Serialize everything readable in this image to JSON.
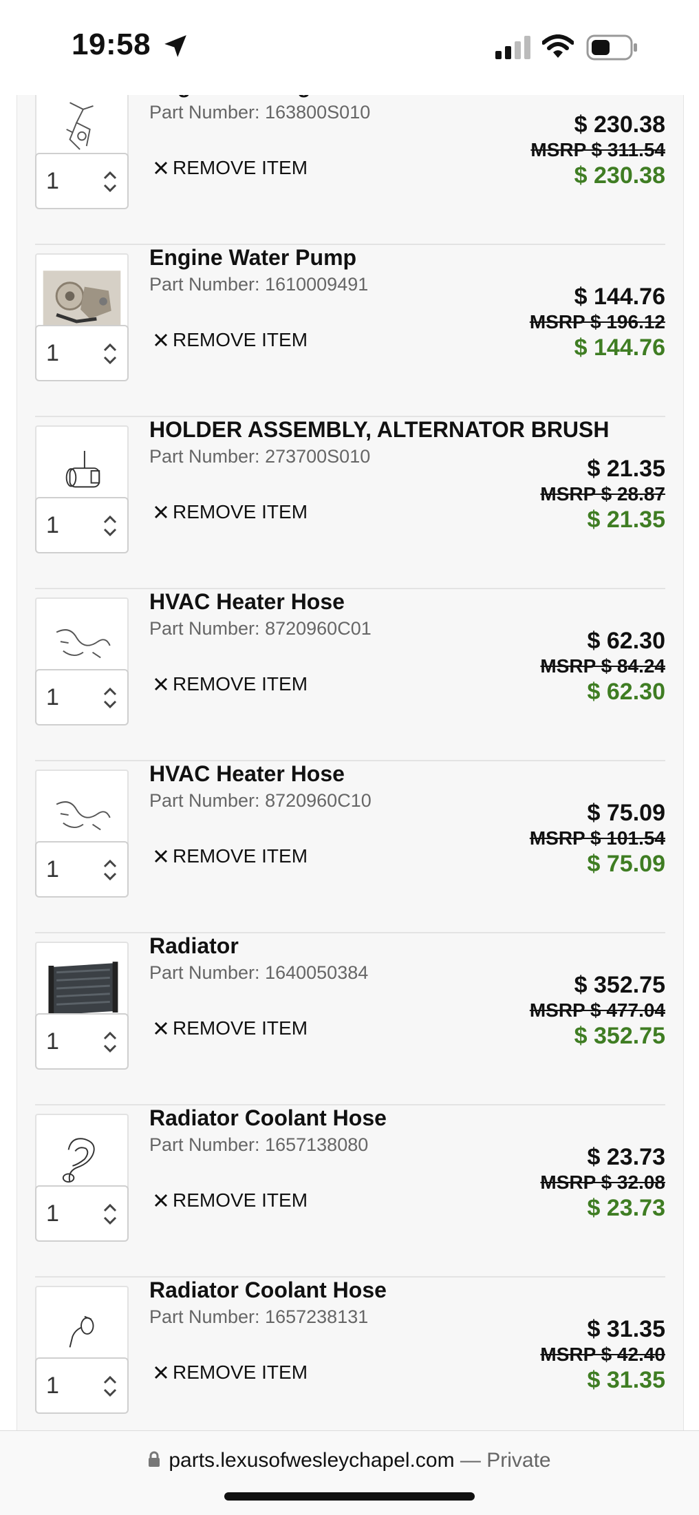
{
  "status_bar": {
    "time": "19:58"
  },
  "cart": {
    "items": [
      {
        "name": "Engine Cooling Fan Clutch Bracket",
        "part_label": "Part Number:",
        "part_number": "163800S010",
        "qty": "1",
        "remove_label": "REMOVE ITEM",
        "price": "$ 230.38",
        "msrp": "MSRP $ 311.54",
        "sale_price": "$ 230.38",
        "image": "bracket-drawing"
      },
      {
        "name": "Engine Water Pump",
        "part_label": "Part Number:",
        "part_number": "1610009491",
        "qty": "1",
        "remove_label": "REMOVE ITEM",
        "price": "$ 144.76",
        "msrp": "MSRP $ 196.12",
        "sale_price": "$ 144.76",
        "image": "water-pump-photo"
      },
      {
        "name": "HOLDER ASSEMBLY, ALTERNATOR BRUSH",
        "part_label": "Part Number:",
        "part_number": "273700S010",
        "qty": "1",
        "remove_label": "REMOVE ITEM",
        "price": "$ 21.35",
        "msrp": "MSRP $ 28.87",
        "sale_price": "$ 21.35",
        "image": "brush-holder-drawing"
      },
      {
        "name": "HVAC Heater Hose",
        "part_label": "Part Number:",
        "part_number": "8720960C01",
        "qty": "1",
        "remove_label": "REMOVE ITEM",
        "price": "$ 62.30",
        "msrp": "MSRP $ 84.24",
        "sale_price": "$ 62.30",
        "image": "hose-drawing"
      },
      {
        "name": "HVAC Heater Hose",
        "part_label": "Part Number:",
        "part_number": "8720960C10",
        "qty": "1",
        "remove_label": "REMOVE ITEM",
        "price": "$ 75.09",
        "msrp": "MSRP $ 101.54",
        "sale_price": "$ 75.09",
        "image": "hose-drawing"
      },
      {
        "name": "Radiator",
        "part_label": "Part Number:",
        "part_number": "1640050384",
        "qty": "1",
        "remove_label": "REMOVE ITEM",
        "price": "$ 352.75",
        "msrp": "MSRP $ 477.04",
        "sale_price": "$ 352.75",
        "image": "radiator-photo"
      },
      {
        "name": "Radiator Coolant Hose",
        "part_label": "Part Number:",
        "part_number": "1657138080",
        "qty": "1",
        "remove_label": "REMOVE ITEM",
        "price": "$ 23.73",
        "msrp": "MSRP $ 32.08",
        "sale_price": "$ 23.73",
        "image": "coolant-hose-drawing"
      },
      {
        "name": "Radiator Coolant Hose",
        "part_label": "Part Number:",
        "part_number": "1657238131",
        "qty": "1",
        "remove_label": "REMOVE ITEM",
        "price": "$ 31.35",
        "msrp": "MSRP $ 42.40",
        "sale_price": "$ 31.35",
        "image": "small-hose-drawing"
      }
    ]
  },
  "browser": {
    "url": "parts.lexusofwesleychapel.com",
    "separator": "—",
    "mode": "Private"
  },
  "colors": {
    "sale_price": "#3f7d23",
    "page_bg": "#f7f7f7"
  }
}
